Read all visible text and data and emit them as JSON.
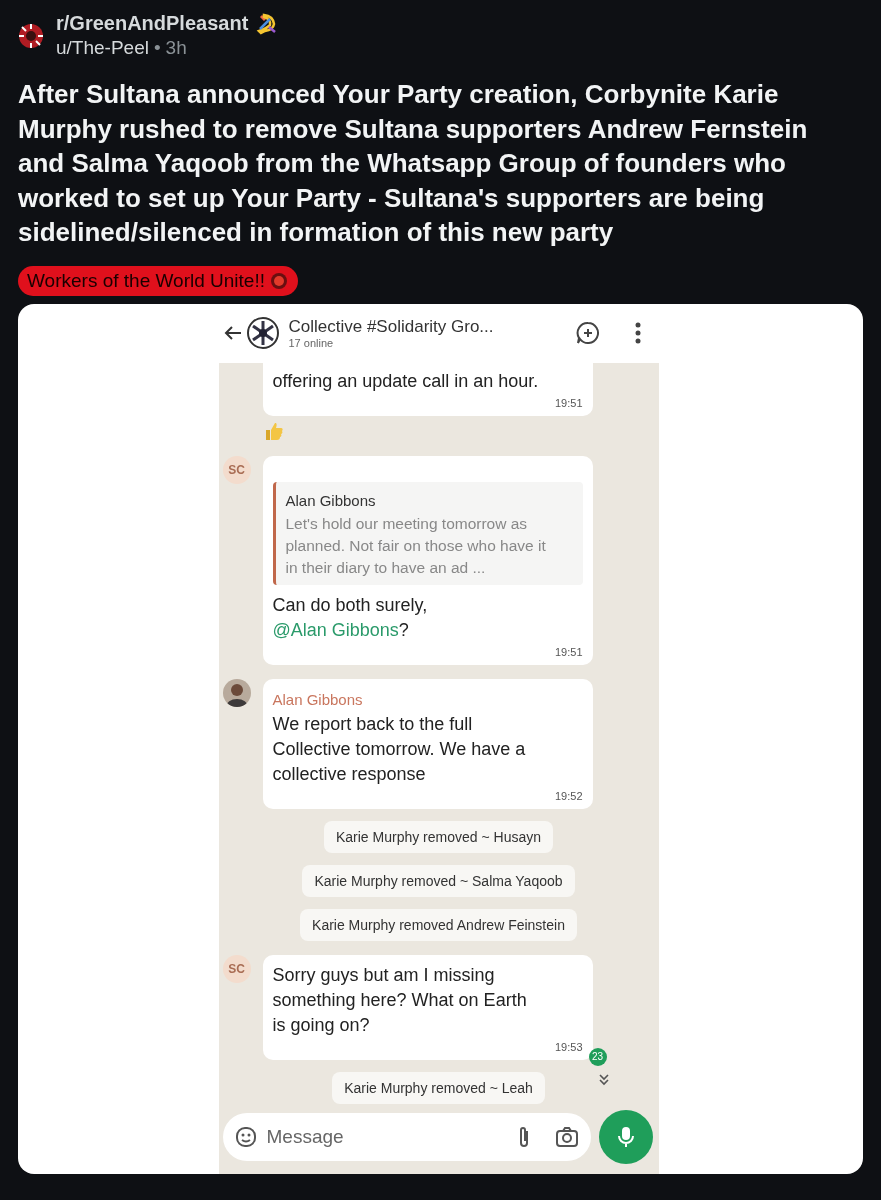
{
  "post": {
    "subreddit": "r/GreenAndPleasant",
    "author": "u/The-Peel",
    "separator": "•",
    "age": "3h",
    "title": "After Sultana announced Your Party creation, Corbynite Karie Murphy rushed to remove Sultana supporters Andrew Fernstein and Salma Yaqoob from the Whatsapp Group of founders who worked to set up Your Party - Sultana's supporters are being sidelined/silenced in formation of this new party",
    "flair": "Workers of the World Unite!!"
  },
  "chat": {
    "group_name": "Collective #Solidarity Gro...",
    "status": "17 online",
    "messages": [
      {
        "kind": "text",
        "text": "offering an update call in an hour.",
        "time": "19:51"
      },
      {
        "kind": "reaction"
      },
      {
        "kind": "reply",
        "avatar": {
          "kind": "initials",
          "text": "SC"
        },
        "quote": {
          "author": "Alan Gibbons",
          "text": "Let's hold our meeting tomorrow as planned. Not fair on those who have it in their diary to have an ad ..."
        },
        "text": "Can do both surely, ",
        "mention": "@Alan Gibbons",
        "after": "?",
        "time": "19:51"
      },
      {
        "kind": "text",
        "avatar": {
          "kind": "photo"
        },
        "sender": "Alan Gibbons",
        "text": "We report back to the full Collective tomorrow. We have a collective response",
        "time": "19:52"
      },
      {
        "kind": "system",
        "text": "Karie Murphy removed ~ Husayn"
      },
      {
        "kind": "system",
        "text": "Karie Murphy removed ~ Salma Yaqoob"
      },
      {
        "kind": "system",
        "text": "Karie Murphy removed Andrew Feinstein"
      },
      {
        "kind": "text",
        "avatar": {
          "kind": "initials",
          "text": "SC"
        },
        "text": "Sorry guys but am I missing something here? What on Earth is going on?",
        "time": "19:53",
        "unread": "23"
      },
      {
        "kind": "system",
        "text": "Karie Murphy removed ~ Leah"
      }
    ],
    "composer": {
      "placeholder": "Message"
    }
  }
}
